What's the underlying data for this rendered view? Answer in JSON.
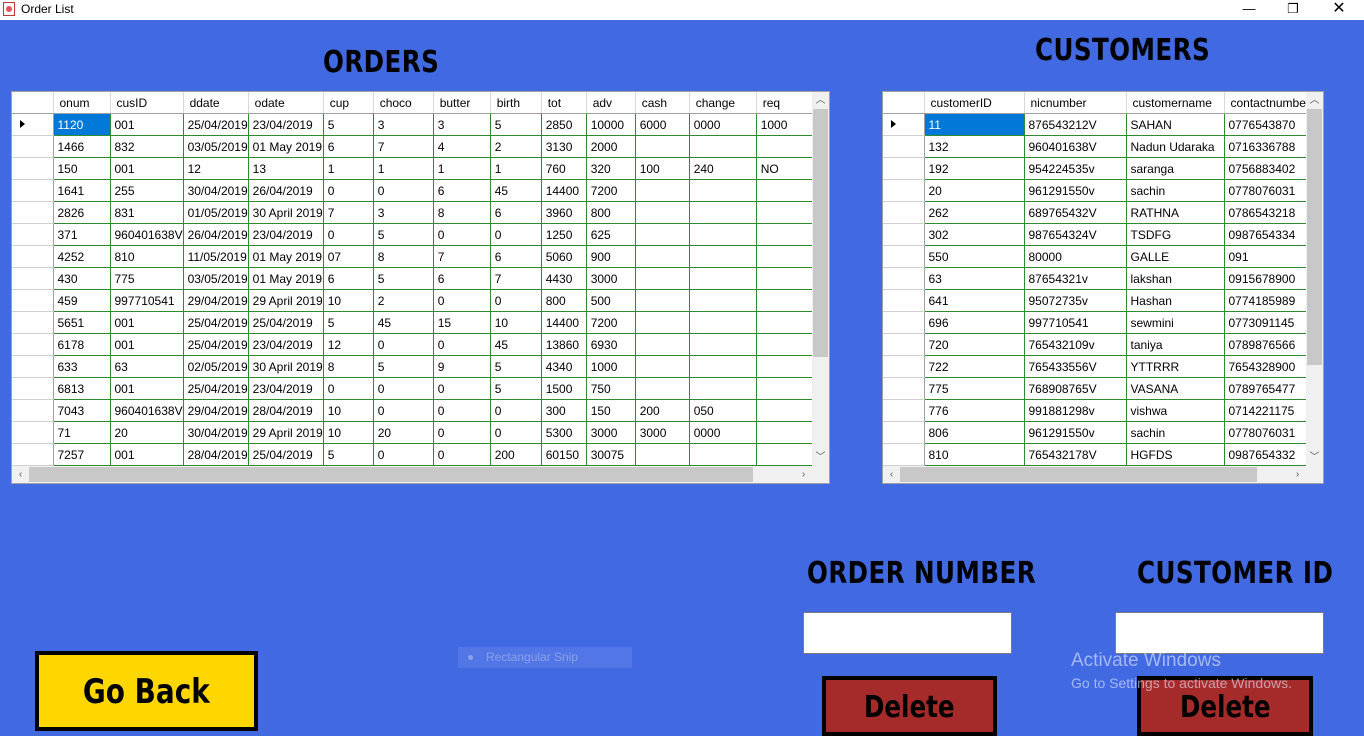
{
  "window": {
    "title": "Order List",
    "minimize": "—",
    "maximize": "❐",
    "close": "✕"
  },
  "headings": {
    "orders": "ORDERS",
    "customers": "CUSTOMERS",
    "order_number": "ORDER NUMBER",
    "customer_id": "CUSTOMER ID"
  },
  "orders": {
    "columns": [
      "onum",
      "cusID",
      "ddate",
      "odate",
      "cup",
      "choco",
      "butter",
      "birth",
      "tot",
      "adv",
      "cash",
      "change",
      "req"
    ],
    "rows": [
      [
        "1120",
        "001",
        "25/04/2019",
        "23/04/2019",
        "5",
        "3",
        "3",
        "5",
        "2850",
        "10000",
        "6000",
        "0000",
        "1000"
      ],
      [
        "1466",
        "832",
        "03/05/2019",
        "01 May 2019",
        "6",
        "7",
        "4",
        "2",
        "3130",
        "2000",
        "",
        "",
        ""
      ],
      [
        "150",
        "001",
        "12",
        "13",
        "1",
        "1",
        "1",
        "1",
        "760",
        "320",
        "100",
        "240",
        "NO"
      ],
      [
        "1641",
        "255",
        "30/04/2019",
        "26/04/2019",
        "0",
        "0",
        "6",
        "45",
        "14400",
        "7200",
        "",
        "",
        ""
      ],
      [
        "2826",
        "831",
        "01/05/2019",
        "30 April 2019",
        "7",
        "3",
        "8",
        "6",
        "3960",
        "800",
        "",
        "",
        ""
      ],
      [
        "371",
        "960401638V",
        "26/04/2019",
        "23/04/2019",
        "0",
        "5",
        "0",
        "0",
        "1250",
        "625",
        "",
        "",
        ""
      ],
      [
        "4252",
        "810",
        "11/05/2019",
        "01 May 2019",
        "07",
        "8",
        "7",
        "6",
        "5060",
        "900",
        "",
        "",
        ""
      ],
      [
        "430",
        "775",
        "03/05/2019",
        "01 May 2019",
        "6",
        "5",
        "6",
        "7",
        "4430",
        "3000",
        "",
        "",
        ""
      ],
      [
        "459",
        "997710541",
        "29/04/2019",
        "29 April 2019",
        "10",
        "2",
        "0",
        "0",
        "800",
        "500",
        "",
        "",
        ""
      ],
      [
        "5651",
        "001",
        "25/04/2019",
        "25/04/2019",
        "5",
        "45",
        "15",
        "10",
        "14400",
        "7200",
        "",
        "",
        ""
      ],
      [
        "6178",
        "001",
        "25/04/2019",
        "23/04/2019",
        "12",
        "0",
        "0",
        "45",
        "13860",
        "6930",
        "",
        "",
        ""
      ],
      [
        "633",
        "63",
        "02/05/2019",
        "30 April 2019",
        "8",
        "5",
        "9",
        "5",
        "4340",
        "1000",
        "",
        "",
        ""
      ],
      [
        "6813",
        "001",
        "25/04/2019",
        "23/04/2019",
        "0",
        "0",
        "0",
        "5",
        "1500",
        "750",
        "",
        "",
        ""
      ],
      [
        "7043",
        "960401638V",
        "29/04/2019",
        "28/04/2019",
        "10",
        "0",
        "0",
        "0",
        "300",
        "150",
        "200",
        "050",
        ""
      ],
      [
        "71",
        "20",
        "30/04/2019",
        "29 April 2019",
        "10",
        "20",
        "0",
        "0",
        "5300",
        "3000",
        "3000",
        "0000",
        ""
      ],
      [
        "7257",
        "001",
        "28/04/2019",
        "25/04/2019",
        "5",
        "0",
        "0",
        "200",
        "60150",
        "30075",
        "",
        "",
        ""
      ]
    ]
  },
  "customers": {
    "columns": [
      "customerID",
      "nicnumber",
      "customername",
      "contactnumber"
    ],
    "rows": [
      [
        "11",
        "876543212V",
        "SAHAN",
        "0776543870"
      ],
      [
        "132",
        "960401638V",
        "Nadun Udaraka",
        "0716336788"
      ],
      [
        "192",
        "954224535v",
        "saranga",
        "0756883402"
      ],
      [
        "20",
        "961291550v",
        "sachin",
        "0778076031"
      ],
      [
        "262",
        "689765432V",
        "RATHNA",
        "0786543218"
      ],
      [
        "302",
        "987654324V",
        "TSDFG",
        "0987654334"
      ],
      [
        "550",
        "80000",
        "GALLE",
        "091"
      ],
      [
        "63",
        "87654321v",
        "lakshan",
        "0915678900"
      ],
      [
        "641",
        "95072735v",
        "Hashan",
        "0774185989"
      ],
      [
        "696",
        "997710541",
        "sewmini",
        "0773091145"
      ],
      [
        "720",
        "765432109v",
        "taniya",
        "0789876566"
      ],
      [
        "722",
        "765433556V",
        "YTTRRR",
        "7654328900"
      ],
      [
        "775",
        "768908765V",
        "VASANA",
        "0789765477"
      ],
      [
        "776",
        "991881298v",
        "vishwa",
        "0714221175"
      ],
      [
        "806",
        "961291550v",
        "sachin",
        "0778076031"
      ],
      [
        "810",
        "765432178V",
        "HGFDS",
        "0987654332"
      ]
    ]
  },
  "inputs": {
    "order_number_value": "",
    "customer_id_value": ""
  },
  "buttons": {
    "go_back": "Go Back",
    "delete_order": "Delete",
    "delete_customer": "Delete"
  },
  "overlay": {
    "snip_label": "Rectangular Snip",
    "activate_title": "Activate Windows",
    "activate_sub": "Go to Settings to activate Windows."
  },
  "colors": {
    "background": "#4169E1",
    "go_back": "#FFD700",
    "delete": "#A52A2A",
    "grid_lines": "#2E8B2E",
    "selection": "#0078D7"
  }
}
